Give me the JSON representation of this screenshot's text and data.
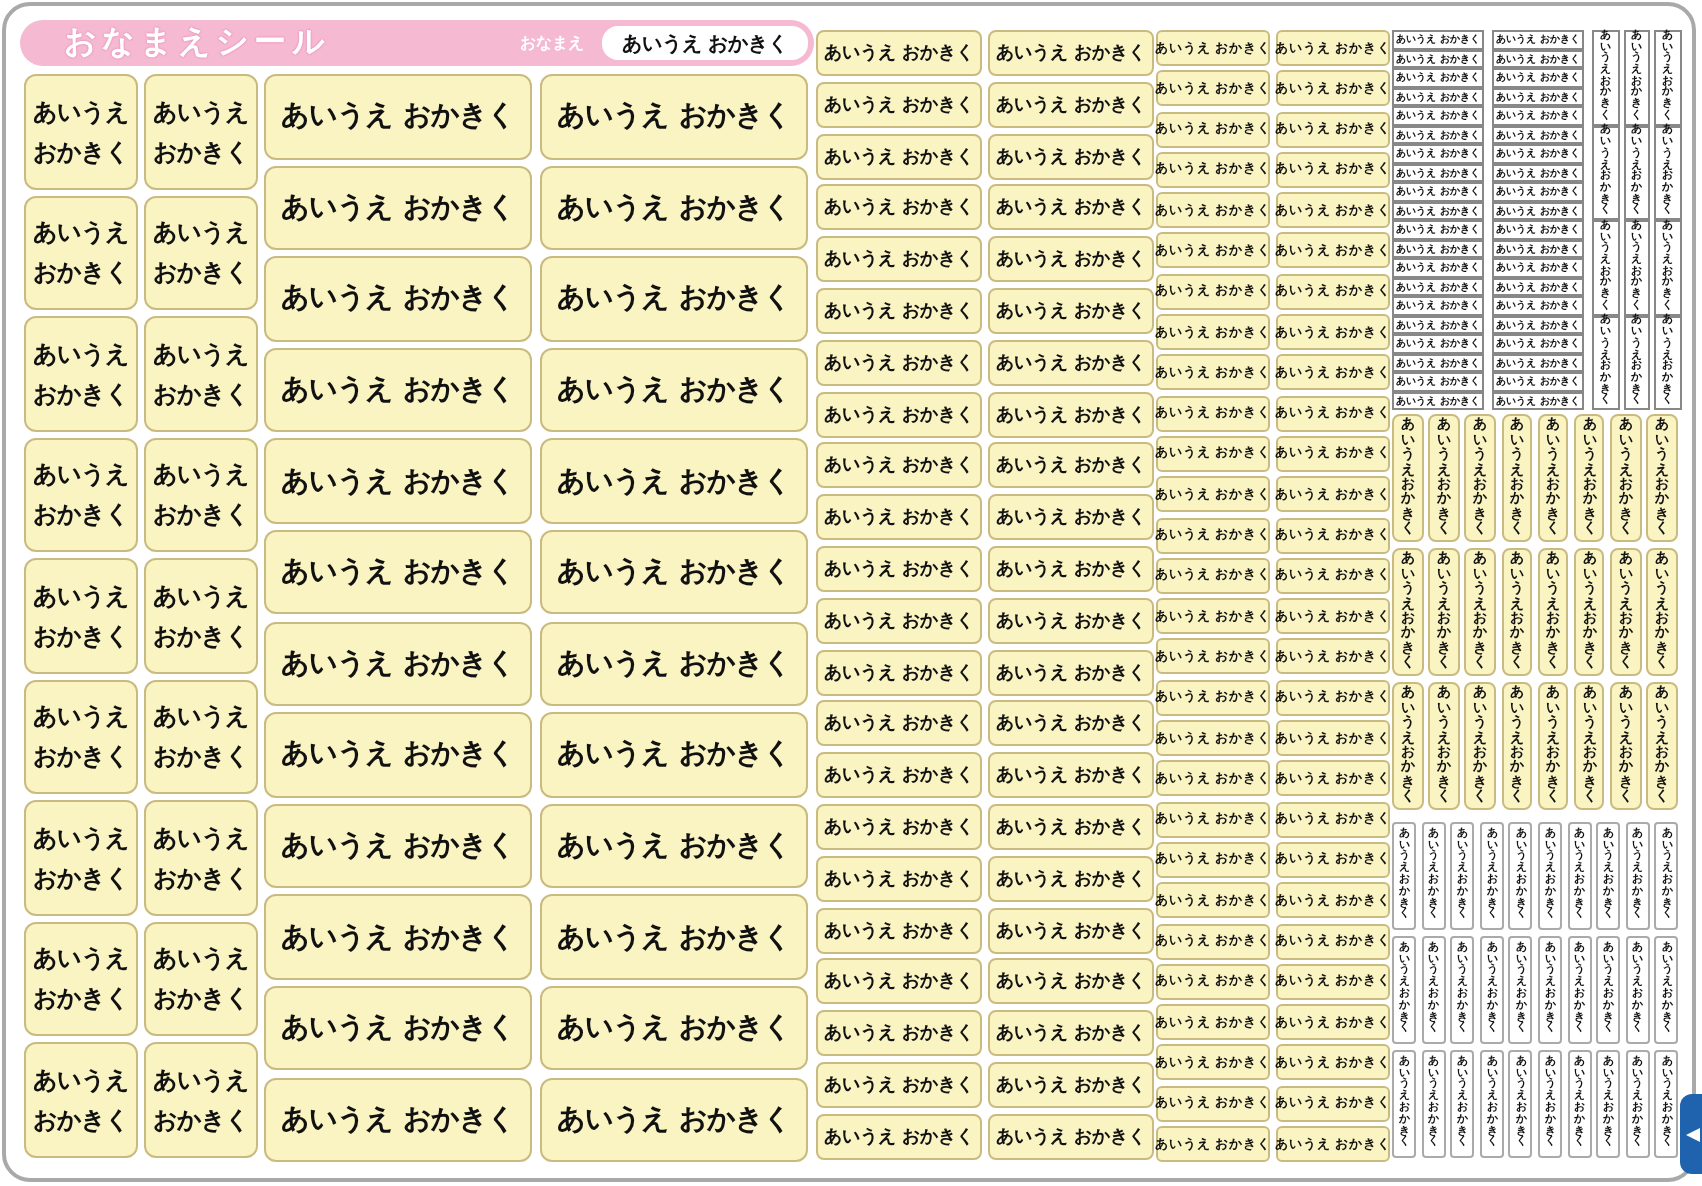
{
  "header": {
    "title": "おなまえシール",
    "name_label": "おなまえ",
    "name_value": "あいうえ おかきく"
  },
  "sticker_groups": [
    {
      "kind": "two-line",
      "stickers": [
        "あいうえおかきく",
        "あいうえおかきく",
        "あいうえおかきく",
        "あいうえおかきく",
        "あいうえおかきく",
        "あいうえおかきく",
        "あいうえおかきく",
        "あいうえおかきく",
        "あいうえおかきく",
        "あいうえおかきく",
        "あいうえおかきく",
        "あいうえおかきく",
        "あいうえおかきく",
        "あいうえおかきく",
        "あいうえおかきく",
        "あいうえおかきく",
        "あいうえおかきく",
        "あいうえおかきく"
      ]
    },
    {
      "kind": "wide",
      "stickers": [
        "あいうえ おかきく",
        "あいうえ おかきく",
        "あいうえ おかきく",
        "あいうえ おかきく",
        "あいうえ おかきく",
        "あいうえ おかきく",
        "あいうえ おかきく",
        "あいうえ おかきく",
        "あいうえ おかきく",
        "あいうえ おかきく",
        "あいうえ おかきく",
        "あいうえ おかきく",
        "あいうえ おかきく",
        "あいうえ おかきく",
        "あいうえ おかきく",
        "あいうえ おかきく",
        "あいうえ おかきく",
        "あいうえ おかきく",
        "あいうえ おかきく",
        "あいうえ おかきく",
        "あいうえ おかきく",
        "あいうえ おかきく",
        "あいうえ おかきく",
        "あいうえ おかきく"
      ]
    },
    {
      "kind": "medium",
      "stickers": [
        "あいうえ おかきく",
        "あいうえ おかきく",
        "あいうえ おかきく",
        "あいうえ おかきく",
        "あいうえ おかきく",
        "あいうえ おかきく",
        "あいうえ おかきく",
        "あいうえ おかきく",
        "あいうえ おかきく",
        "あいうえ おかきく",
        "あいうえ おかきく",
        "あいうえ おかきく",
        "あいうえ おかきく",
        "あいうえ おかきく",
        "あいうえ おかきく",
        "あいうえ おかきく",
        "あいうえ おかきく",
        "あいうえ おかきく",
        "あいうえ おかきく",
        "あいうえ おかきく",
        "あいうえ おかきく",
        "あいうえ おかきく",
        "あいうえ おかきく",
        "あいうえ おかきく",
        "あいうえ おかきく",
        "あいうえ おかきく",
        "あいうえ おかきく",
        "あいうえ おかきく",
        "あいうえ おかきく",
        "あいうえ おかきく",
        "あいうえ おかきく",
        "あいうえ おかきく",
        "あいうえ おかきく",
        "あいうえ おかきく",
        "あいうえ おかきく",
        "あいうえ おかきく",
        "あいうえ おかきく",
        "あいうえ おかきく",
        "あいうえ おかきく",
        "あいうえ おかきく",
        "あいうえ おかきく",
        "あいうえ おかきく",
        "あいうえ おかきく",
        "あいうえ おかきく"
      ]
    },
    {
      "kind": "small",
      "stickers": [
        "あいうえ おかきく",
        "あいうえ おかきく",
        "あいうえ おかきく",
        "あいうえ おかきく",
        "あいうえ おかきく",
        "あいうえ おかきく",
        "あいうえ おかきく",
        "あいうえ おかきく",
        "あいうえ おかきく",
        "あいうえ おかきく",
        "あいうえ おかきく",
        "あいうえ おかきく",
        "あいうえ おかきく",
        "あいうえ おかきく",
        "あいうえ おかきく",
        "あいうえ おかきく",
        "あいうえ おかきく",
        "あいうえ おかきく",
        "あいうえ おかきく",
        "あいうえ おかきく",
        "あいうえ おかきく",
        "あいうえ おかきく",
        "あいうえ おかきく",
        "あいうえ おかきく",
        "あいうえ おかきく",
        "あいうえ おかきく",
        "あいうえ おかきく",
        "あいうえ おかきく",
        "あいうえ おかきく",
        "あいうえ おかきく",
        "あいうえ おかきく",
        "あいうえ おかきく",
        "あいうえ おかきく",
        "あいうえ おかきく",
        "あいうえ おかきく",
        "あいうえ おかきく",
        "あいうえ おかきく",
        "あいうえ おかきく",
        "あいうえ おかきく",
        "あいうえ おかきく",
        "あいうえ おかきく",
        "あいうえ おかきく",
        "あいうえ おかきく",
        "あいうえ おかきく",
        "あいうえ おかきく",
        "あいうえ おかきく",
        "あいうえ おかきく",
        "あいうえ おかきく",
        "あいうえ おかきく",
        "あいうえ おかきく",
        "あいうえ おかきく",
        "あいうえ おかきく",
        "あいうえ おかきく",
        "あいうえ おかきく",
        "あいうえ おかきく",
        "あいうえ おかきく"
      ]
    },
    {
      "kind": "mini",
      "stickers": [
        "あいうえ おかきく",
        "あいうえ おかきく",
        "あいうえ おかきく",
        "あいうえ おかきく",
        "あいうえ おかきく",
        "あいうえ おかきく",
        "あいうえ おかきく",
        "あいうえ おかきく",
        "あいうえ おかきく",
        "あいうえ おかきく",
        "あいうえ おかきく",
        "あいうえ おかきく",
        "あいうえ おかきく",
        "あいうえ おかきく",
        "あいうえ おかきく",
        "あいうえ おかきく",
        "あいうえ おかきく",
        "あいうえ おかきく",
        "あいうえ おかきく",
        "あいうえ おかきく",
        "あいうえ おかきく",
        "あいうえ おかきく",
        "あいうえ おかきく",
        "あいうえ おかきく",
        "あいうえ おかきく",
        "あいうえ おかきく",
        "あいうえ おかきく",
        "あいうえ おかきく",
        "あいうえ おかきく",
        "あいうえ おかきく",
        "あいうえ おかきく",
        "あいうえ おかきく",
        "あいうえ おかきく",
        "あいうえ おかきく",
        "あいうえ おかきく",
        "あいうえ おかきく",
        "あいうえ おかきく",
        "あいうえ おかきく",
        "あいうえ おかきく",
        "あいうえ おかきく"
      ]
    },
    {
      "kind": "mini-vertical",
      "stickers": [
        "あいうえおかきく",
        "あいうえおかきく",
        "あいうえおかきく",
        "あいうえおかきく",
        "あいうえおかきく",
        "あいうえおかきく",
        "あいうえおかきく",
        "あいうえおかきく",
        "あいうえおかきく",
        "あいうえおかきく",
        "あいうえおかきく",
        "あいうえおかきく"
      ]
    },
    {
      "kind": "vertical",
      "stickers": [
        "あいうえおかきく",
        "あいうえおかきく",
        "あいうえおかきく",
        "あいうえおかきく",
        "あいうえおかきく",
        "あいうえおかきく",
        "あいうえおかきく",
        "あいうえおかきく",
        "あいうえおかきく",
        "あいうえおかきく",
        "あいうえおかきく",
        "あいうえおかきく",
        "あいうえおかきく",
        "あいうえおかきく",
        "あいうえおかきく",
        "あいうえおかきく",
        "あいうえおかきく",
        "あいうえおかきく",
        "あいうえおかきく",
        "あいうえおかきく",
        "あいうえおかきく",
        "あいうえおかきく",
        "あいうえおかきく",
        "あいうえおかきく"
      ]
    },
    {
      "kind": "vertical-white",
      "stickers": [
        "あいうえおかきく",
        "あいうえおかきく",
        "あいうえおかきく",
        "あいうえおかきく",
        "あいうえおかきく",
        "あいうえおかきく",
        "あいうえおかきく",
        "あいうえおかきく",
        "あいうえおかきく",
        "あいうえおかきく",
        "あいうえおかきく",
        "あいうえおかきく",
        "あいうえおかきく",
        "あいうえおかきく",
        "あいうえおかきく",
        "あいうえおかきく",
        "あいうえおかきく",
        "あいうえおかきく",
        "あいうえおかきく",
        "あいうえおかきく",
        "あいうえおかきく",
        "あいうえおかきく",
        "あいうえおかきく",
        "あいうえおかきく",
        "あいうえおかきく",
        "あいうえおかきく",
        "あいうえおかきく",
        "あいうえおかきく",
        "あいうえおかきく",
        "あいうえおかきく"
      ]
    }
  ]
}
